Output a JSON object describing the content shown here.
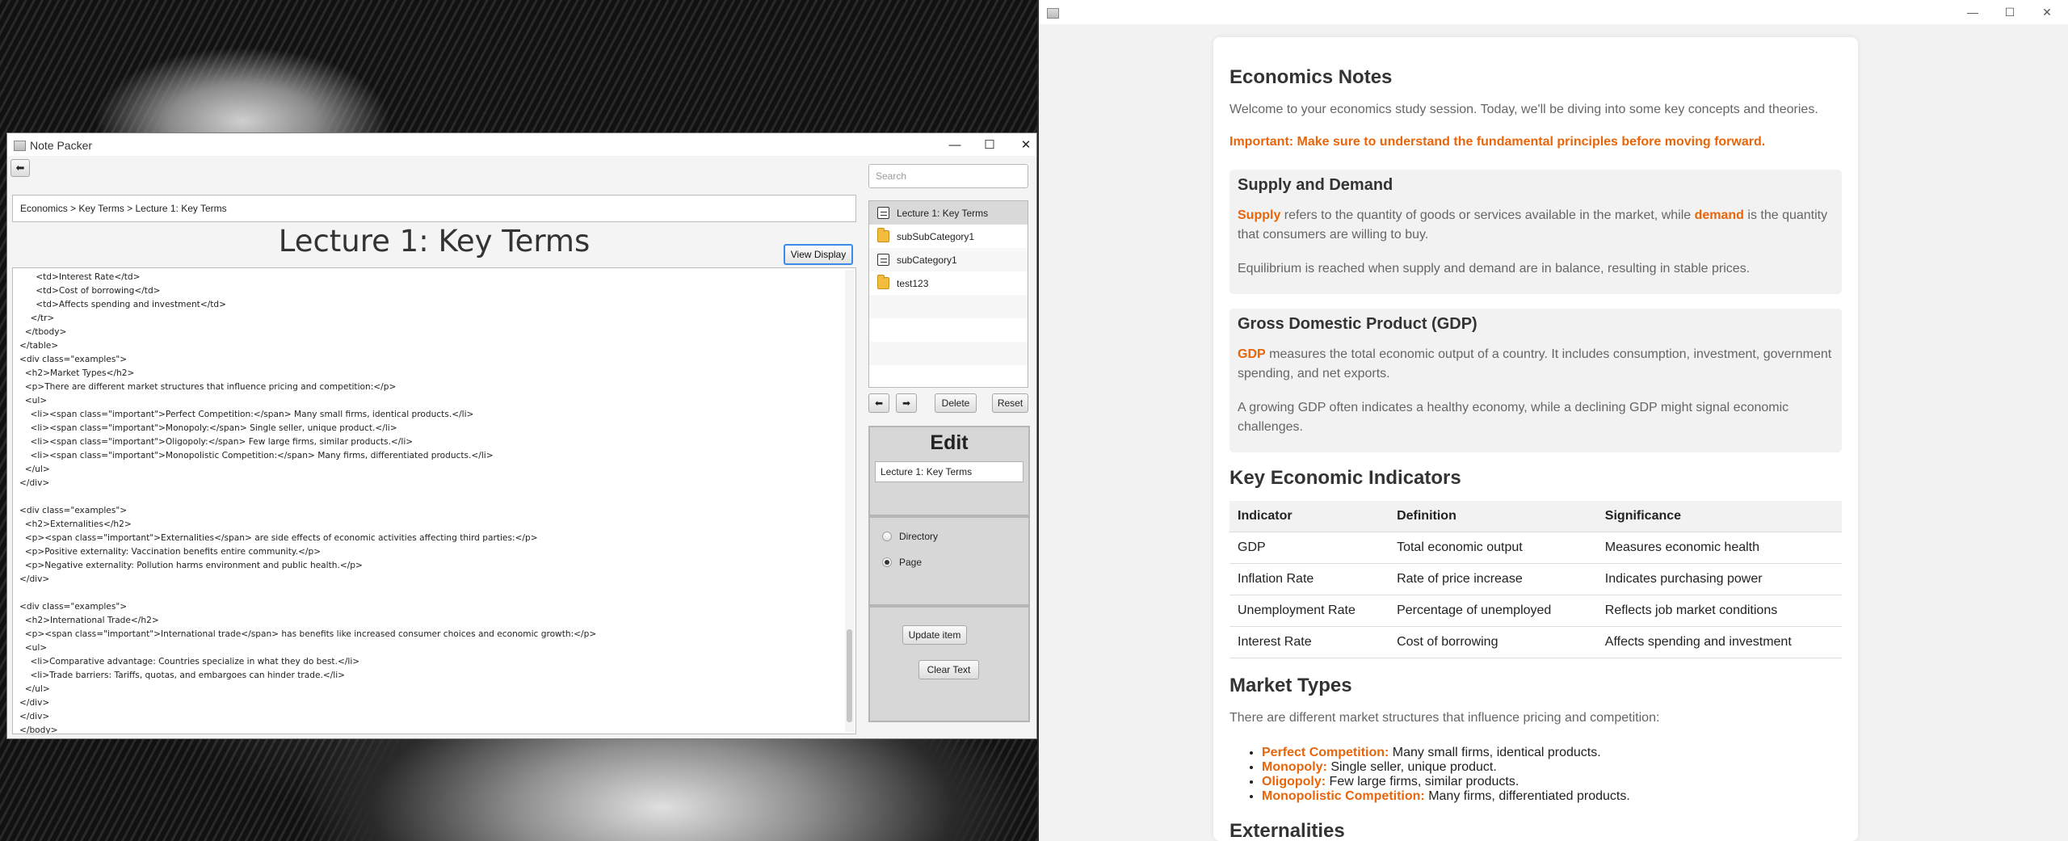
{
  "left_window": {
    "title": "Note Packer",
    "controls": {
      "minimize": "—",
      "maximize": "☐",
      "close": "✕"
    },
    "back_label": "⬅",
    "breadcrumb": "Economics > Key Terms > Lecture 1: Key Terms",
    "page_title": "Lecture 1: Key Terms",
    "view_display_label": "View Display",
    "code": "      <td>Interest Rate</td>\n      <td>Cost of borrowing</td>\n      <td>Affects spending and investment</td>\n    </tr>\n  </tbody>\n</table>\n<div class=\"examples\">\n  <h2>Market Types</h2>\n  <p>There are different market structures that influence pricing and competition:</p>\n  <ul>\n    <li><span class=\"important\">Perfect Competition:</span> Many small firms, identical products.</li>\n    <li><span class=\"important\">Monopoly:</span> Single seller, unique product.</li>\n    <li><span class=\"important\">Oligopoly:</span> Few large firms, similar products.</li>\n    <li><span class=\"important\">Monopolistic Competition:</span> Many firms, differentiated products.</li>\n  </ul>\n</div>\n\n<div class=\"examples\">\n  <h2>Externalities</h2>\n  <p><span class=\"important\">Externalities</span> are side effects of economic activities affecting third parties:</p>\n  <p>Positive externality: Vaccination benefits entire community.</p>\n  <p>Negative externality: Pollution harms environment and public health.</p>\n</div>\n\n<div class=\"examples\">\n  <h2>International Trade</h2>\n  <p><span class=\"important\">International trade</span> has benefits like increased consumer choices and economic growth:</p>\n  <ul>\n    <li>Comparative advantage: Countries specialize in what they do best.</li>\n    <li>Trade barriers: Tariffs, quotas, and embargoes can hinder trade.</li>\n  </ul>\n</div>\n</div>\n</body>",
    "search_placeholder": "Search",
    "tree_items": [
      {
        "label": "Lecture 1: Key Terms",
        "icon": "page-icon"
      },
      {
        "label": "subSubCategory1",
        "icon": "folder-icon"
      },
      {
        "label": "subCategory1",
        "icon": "page-icon"
      },
      {
        "label": "test123",
        "icon": "folder-icon"
      }
    ],
    "move_up_label": "⬅",
    "move_down_label": "➡",
    "delete_label": "Delete",
    "reset_label": "Reset",
    "edit": {
      "heading": "Edit",
      "name_value": "Lecture 1: Key Terms",
      "directory_label": "Directory",
      "page_label": "Page",
      "selected_type": "Page",
      "update_label": "Update item",
      "clear_label": "Clear Text"
    }
  },
  "right_window": {
    "controls": {
      "minimize": "—",
      "maximize": "☐",
      "close": "✕"
    },
    "doc_title": "Economics Notes",
    "intro": "Welcome to your economics study session. Today, we'll be diving into some key concepts and theories.",
    "important_note": "Important: Make sure to understand the fundamental principles before moving forward.",
    "supply": {
      "heading": "Supply and Demand",
      "term1": "Supply",
      "text1": " refers to the quantity of goods or services available in the market, while ",
      "term2": "demand",
      "text2": " is the quantity that consumers are willing to buy.",
      "para2": "Equilibrium is reached when supply and demand are in balance, resulting in stable prices."
    },
    "gdp": {
      "heading": "Gross Domestic Product (GDP)",
      "term": "GDP",
      "text": " measures the total economic output of a country. It includes consumption, investment, government spending, and net exports.",
      "para2": "A growing GDP often indicates a healthy economy, while a declining GDP might signal economic challenges."
    },
    "indicators": {
      "heading": "Key Economic Indicators",
      "headers": [
        "Indicator",
        "Definition",
        "Significance"
      ],
      "rows": [
        [
          "GDP",
          "Total economic output",
          "Measures economic health"
        ],
        [
          "Inflation Rate",
          "Rate of price increase",
          "Indicates purchasing power"
        ],
        [
          "Unemployment Rate",
          "Percentage of unemployed",
          "Reflects job market conditions"
        ],
        [
          "Interest Rate",
          "Cost of borrowing",
          "Affects spending and investment"
        ]
      ]
    },
    "market": {
      "heading": "Market Types",
      "intro": "There are different market structures that influence pricing and competition:",
      "items": [
        {
          "term": "Perfect Competition:",
          "text": " Many small firms, identical products."
        },
        {
          "term": "Monopoly:",
          "text": " Single seller, unique product."
        },
        {
          "term": "Oligopoly:",
          "text": " Few large firms, similar products."
        },
        {
          "term": "Monopolistic Competition:",
          "text": " Many firms, differentiated products."
        }
      ]
    },
    "next_heading_partial": "Externalities"
  }
}
